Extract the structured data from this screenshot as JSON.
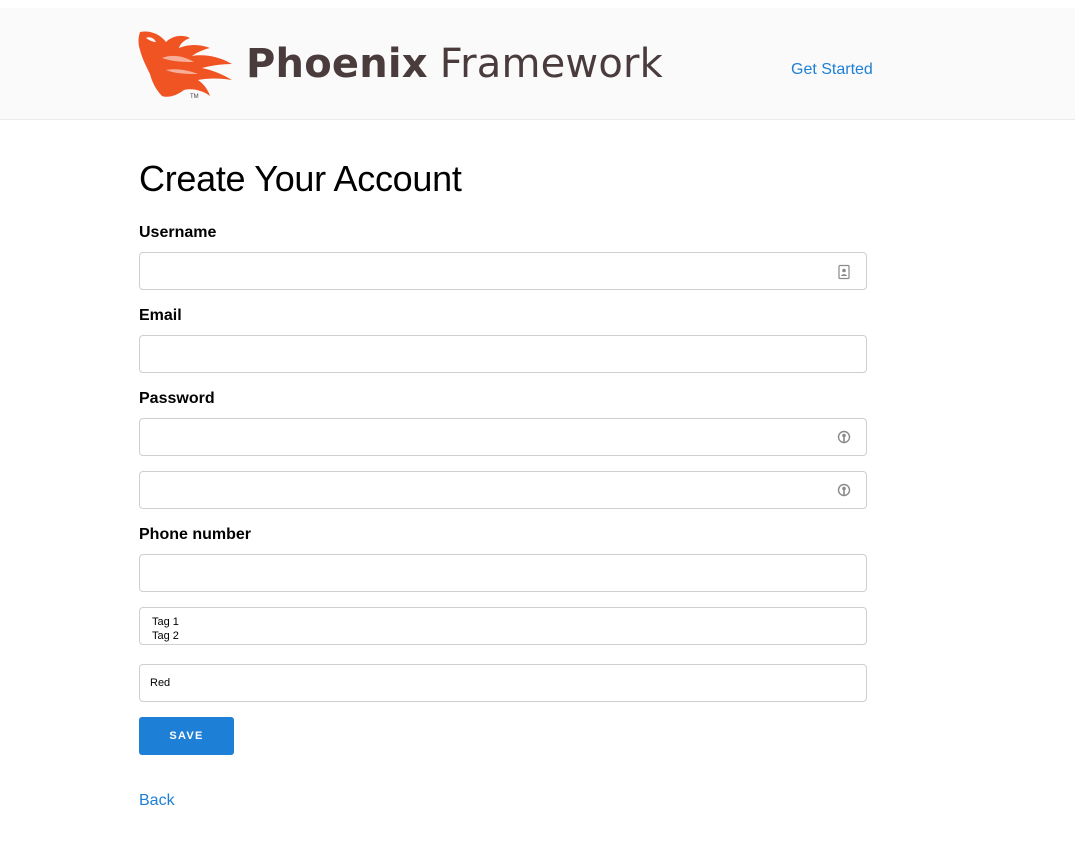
{
  "header": {
    "logo_word_bold": "Phoenix",
    "logo_word_light": "Framework",
    "logo_tm": "TM",
    "nav_link": "Get Started",
    "brand_color": "#f05423"
  },
  "form": {
    "title": "Create Your Account",
    "username_label": "Username",
    "username_value": "",
    "username_icon": "contact-card-icon",
    "email_label": "Email",
    "email_value": "",
    "password_label": "Password",
    "password_value": "",
    "password_confirm_value": "",
    "password_icon": "key-icon",
    "phone_label": "Phone number",
    "phone_value": "",
    "tags_options": [
      "Tag 1",
      "Tag 2"
    ],
    "color_selected": "Red",
    "save_label": "SAVE",
    "back_link": "Back",
    "accent_color": "#1e7fd6"
  }
}
